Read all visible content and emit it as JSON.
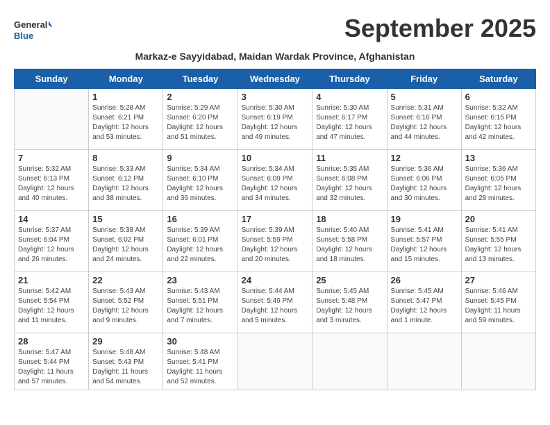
{
  "header": {
    "logo_general": "General",
    "logo_blue": "Blue",
    "month_title": "September 2025",
    "subtitle": "Markaz-e Sayyidabad, Maidan Wardak Province, Afghanistan"
  },
  "weekdays": [
    "Sunday",
    "Monday",
    "Tuesday",
    "Wednesday",
    "Thursday",
    "Friday",
    "Saturday"
  ],
  "weeks": [
    [
      {
        "day": "",
        "sunrise": "",
        "sunset": "",
        "daylight": ""
      },
      {
        "day": "1",
        "sunrise": "Sunrise: 5:28 AM",
        "sunset": "Sunset: 6:21 PM",
        "daylight": "Daylight: 12 hours and 53 minutes."
      },
      {
        "day": "2",
        "sunrise": "Sunrise: 5:29 AM",
        "sunset": "Sunset: 6:20 PM",
        "daylight": "Daylight: 12 hours and 51 minutes."
      },
      {
        "day": "3",
        "sunrise": "Sunrise: 5:30 AM",
        "sunset": "Sunset: 6:19 PM",
        "daylight": "Daylight: 12 hours and 49 minutes."
      },
      {
        "day": "4",
        "sunrise": "Sunrise: 5:30 AM",
        "sunset": "Sunset: 6:17 PM",
        "daylight": "Daylight: 12 hours and 47 minutes."
      },
      {
        "day": "5",
        "sunrise": "Sunrise: 5:31 AM",
        "sunset": "Sunset: 6:16 PM",
        "daylight": "Daylight: 12 hours and 44 minutes."
      },
      {
        "day": "6",
        "sunrise": "Sunrise: 5:32 AM",
        "sunset": "Sunset: 6:15 PM",
        "daylight": "Daylight: 12 hours and 42 minutes."
      }
    ],
    [
      {
        "day": "7",
        "sunrise": "Sunrise: 5:32 AM",
        "sunset": "Sunset: 6:13 PM",
        "daylight": "Daylight: 12 hours and 40 minutes."
      },
      {
        "day": "8",
        "sunrise": "Sunrise: 5:33 AM",
        "sunset": "Sunset: 6:12 PM",
        "daylight": "Daylight: 12 hours and 38 minutes."
      },
      {
        "day": "9",
        "sunrise": "Sunrise: 5:34 AM",
        "sunset": "Sunset: 6:10 PM",
        "daylight": "Daylight: 12 hours and 36 minutes."
      },
      {
        "day": "10",
        "sunrise": "Sunrise: 5:34 AM",
        "sunset": "Sunset: 6:09 PM",
        "daylight": "Daylight: 12 hours and 34 minutes."
      },
      {
        "day": "11",
        "sunrise": "Sunrise: 5:35 AM",
        "sunset": "Sunset: 6:08 PM",
        "daylight": "Daylight: 12 hours and 32 minutes."
      },
      {
        "day": "12",
        "sunrise": "Sunrise: 5:36 AM",
        "sunset": "Sunset: 6:06 PM",
        "daylight": "Daylight: 12 hours and 30 minutes."
      },
      {
        "day": "13",
        "sunrise": "Sunrise: 5:36 AM",
        "sunset": "Sunset: 6:05 PM",
        "daylight": "Daylight: 12 hours and 28 minutes."
      }
    ],
    [
      {
        "day": "14",
        "sunrise": "Sunrise: 5:37 AM",
        "sunset": "Sunset: 6:04 PM",
        "daylight": "Daylight: 12 hours and 26 minutes."
      },
      {
        "day": "15",
        "sunrise": "Sunrise: 5:38 AM",
        "sunset": "Sunset: 6:02 PM",
        "daylight": "Daylight: 12 hours and 24 minutes."
      },
      {
        "day": "16",
        "sunrise": "Sunrise: 5:39 AM",
        "sunset": "Sunset: 6:01 PM",
        "daylight": "Daylight: 12 hours and 22 minutes."
      },
      {
        "day": "17",
        "sunrise": "Sunrise: 5:39 AM",
        "sunset": "Sunset: 5:59 PM",
        "daylight": "Daylight: 12 hours and 20 minutes."
      },
      {
        "day": "18",
        "sunrise": "Sunrise: 5:40 AM",
        "sunset": "Sunset: 5:58 PM",
        "daylight": "Daylight: 12 hours and 18 minutes."
      },
      {
        "day": "19",
        "sunrise": "Sunrise: 5:41 AM",
        "sunset": "Sunset: 5:57 PM",
        "daylight": "Daylight: 12 hours and 15 minutes."
      },
      {
        "day": "20",
        "sunrise": "Sunrise: 5:41 AM",
        "sunset": "Sunset: 5:55 PM",
        "daylight": "Daylight: 12 hours and 13 minutes."
      }
    ],
    [
      {
        "day": "21",
        "sunrise": "Sunrise: 5:42 AM",
        "sunset": "Sunset: 5:54 PM",
        "daylight": "Daylight: 12 hours and 11 minutes."
      },
      {
        "day": "22",
        "sunrise": "Sunrise: 5:43 AM",
        "sunset": "Sunset: 5:52 PM",
        "daylight": "Daylight: 12 hours and 9 minutes."
      },
      {
        "day": "23",
        "sunrise": "Sunrise: 5:43 AM",
        "sunset": "Sunset: 5:51 PM",
        "daylight": "Daylight: 12 hours and 7 minutes."
      },
      {
        "day": "24",
        "sunrise": "Sunrise: 5:44 AM",
        "sunset": "Sunset: 5:49 PM",
        "daylight": "Daylight: 12 hours and 5 minutes."
      },
      {
        "day": "25",
        "sunrise": "Sunrise: 5:45 AM",
        "sunset": "Sunset: 5:48 PM",
        "daylight": "Daylight: 12 hours and 3 minutes."
      },
      {
        "day": "26",
        "sunrise": "Sunrise: 5:45 AM",
        "sunset": "Sunset: 5:47 PM",
        "daylight": "Daylight: 12 hours and 1 minute."
      },
      {
        "day": "27",
        "sunrise": "Sunrise: 5:46 AM",
        "sunset": "Sunset: 5:45 PM",
        "daylight": "Daylight: 11 hours and 59 minutes."
      }
    ],
    [
      {
        "day": "28",
        "sunrise": "Sunrise: 5:47 AM",
        "sunset": "Sunset: 5:44 PM",
        "daylight": "Daylight: 11 hours and 57 minutes."
      },
      {
        "day": "29",
        "sunrise": "Sunrise: 5:48 AM",
        "sunset": "Sunset: 5:43 PM",
        "daylight": "Daylight: 11 hours and 54 minutes."
      },
      {
        "day": "30",
        "sunrise": "Sunrise: 5:48 AM",
        "sunset": "Sunset: 5:41 PM",
        "daylight": "Daylight: 11 hours and 52 minutes."
      },
      {
        "day": "",
        "sunrise": "",
        "sunset": "",
        "daylight": ""
      },
      {
        "day": "",
        "sunrise": "",
        "sunset": "",
        "daylight": ""
      },
      {
        "day": "",
        "sunrise": "",
        "sunset": "",
        "daylight": ""
      },
      {
        "day": "",
        "sunrise": "",
        "sunset": "",
        "daylight": ""
      }
    ]
  ]
}
